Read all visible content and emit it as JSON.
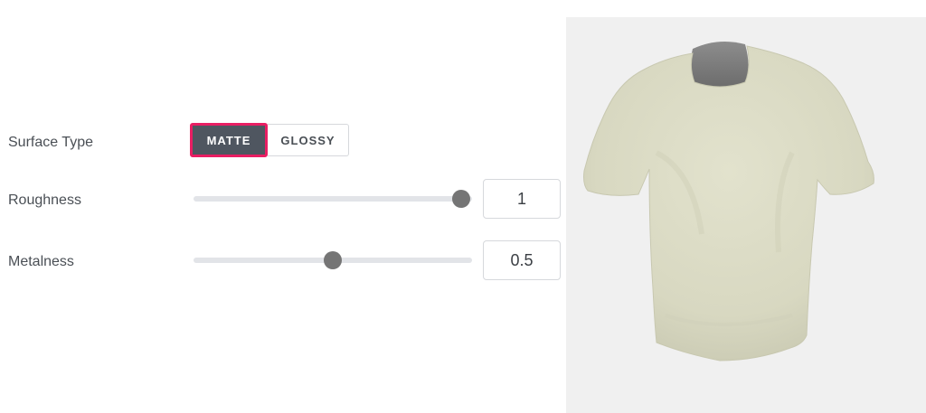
{
  "surface_type": {
    "label": "Surface Type",
    "options": [
      "MATTE",
      "GLOSSY"
    ],
    "selected": "MATTE"
  },
  "roughness": {
    "label": "Roughness",
    "value": "1",
    "fraction": 1.0
  },
  "metalness": {
    "label": "Metalness",
    "value": "0.5",
    "fraction": 0.5
  },
  "colors": {
    "accent": "#e91e63",
    "selected_bg": "#4f5660",
    "shirt": "#dcdcc6",
    "preview_bg": "#f0f0f0"
  },
  "preview": {
    "icon": "tshirt-model"
  }
}
